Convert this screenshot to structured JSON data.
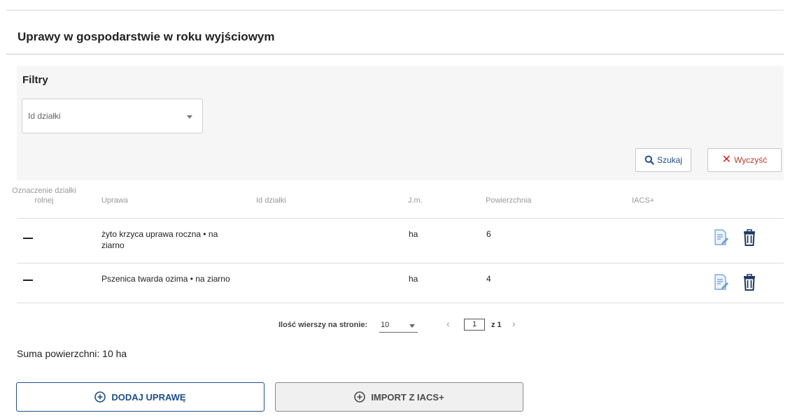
{
  "section": {
    "title": "Uprawy w gospodarstwie w roku wyjściowym"
  },
  "filters": {
    "label": "Filtry",
    "plot_id_select": {
      "placeholder": "Id działki"
    },
    "search_label": "Szukaj",
    "clear_label": "Wyczyść"
  },
  "table": {
    "headers": {
      "oznaczenie": "Oznaczenie działki rolnej",
      "uprawa": "Uprawa",
      "id_dzialki": "Id działki",
      "jm": "J.m.",
      "powierzchnia": "Powierzchnia",
      "iacs": "IACS+"
    },
    "rows": [
      {
        "oznaczenie": "",
        "uprawa": "żyto krzyca uprawa roczna • na ziarno",
        "id_dzialki": "",
        "jm": "ha",
        "powierzchnia": "6",
        "iacs": ""
      },
      {
        "oznaczenie": "",
        "uprawa": "Pszenica twarda ozima • na ziarno",
        "id_dzialki": "",
        "jm": "ha",
        "powierzchnia": "4",
        "iacs": ""
      }
    ]
  },
  "pagination": {
    "rows_per_page_label": "Ilość wierszy na stronie:",
    "rows_per_page_value": "10",
    "current_page": "1",
    "of_pages": "z 1"
  },
  "summary": {
    "total_area": "Suma powierzchni: 10 ha"
  },
  "actions": {
    "add_label": "DODAJ UPRAWĘ",
    "import_label": "IMPORT Z IACS+"
  },
  "colors": {
    "primary": "#1f4f8a",
    "danger": "#d11f1f",
    "panel_bg": "#f6f6f6"
  }
}
